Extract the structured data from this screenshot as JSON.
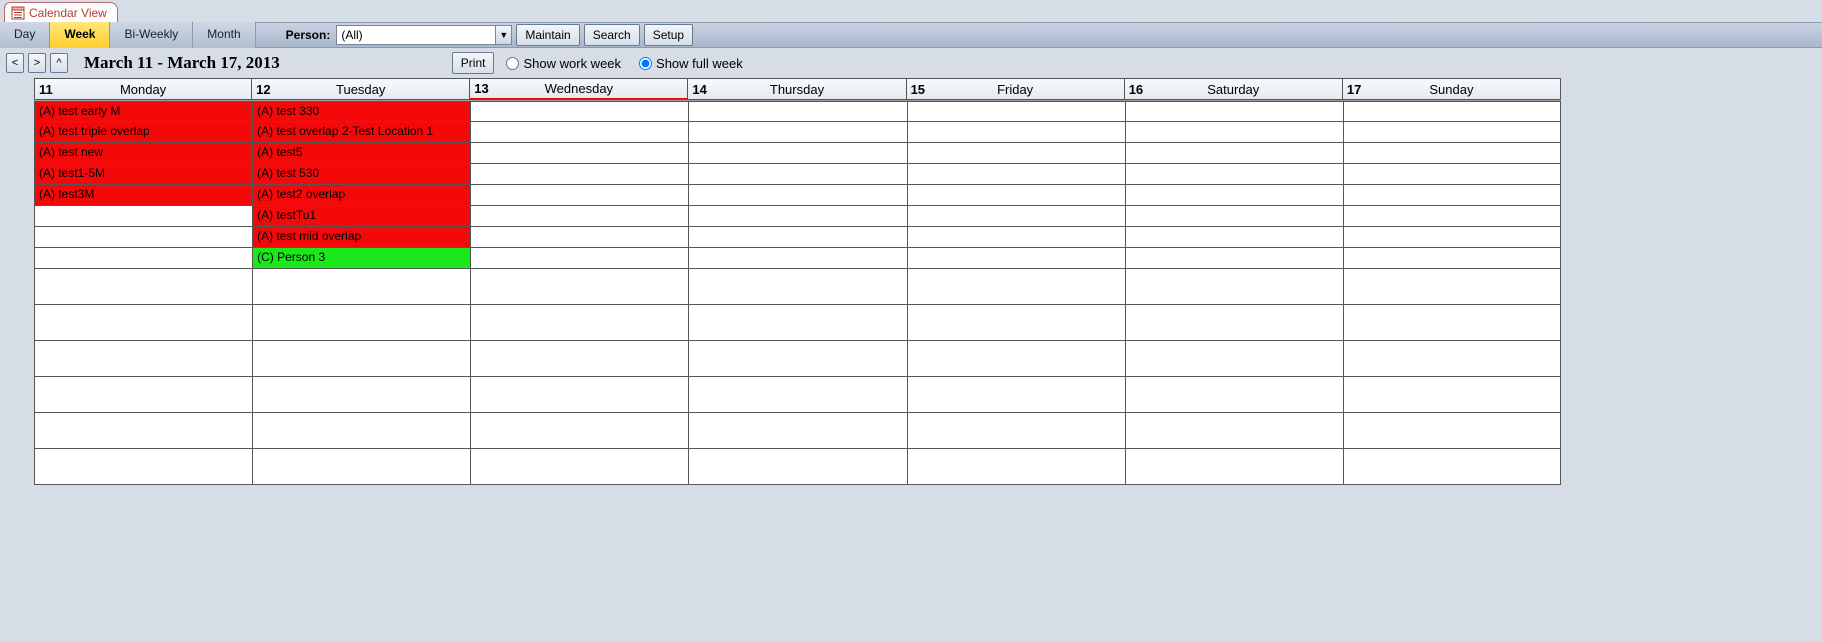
{
  "tab": {
    "label": "Calendar View"
  },
  "views": {
    "day": "Day",
    "week": "Week",
    "biweekly": "Bi-Weekly",
    "month": "Month",
    "active": "week"
  },
  "person": {
    "label": "Person:",
    "selected": "(All)"
  },
  "actions": {
    "maintain": "Maintain",
    "search": "Search",
    "setup": "Setup",
    "print": "Print"
  },
  "nav": {
    "prev": "<",
    "next": ">",
    "up": "^"
  },
  "date_range": "March 11 - March 17, 2013",
  "weekmode": {
    "work_label": "Show work week",
    "full_label": "Show full week",
    "selected": "full"
  },
  "days": [
    {
      "num": "11",
      "name": "Monday"
    },
    {
      "num": "12",
      "name": "Tuesday"
    },
    {
      "num": "13",
      "name": "Wednesday"
    },
    {
      "num": "14",
      "name": "Thursday"
    },
    {
      "num": "15",
      "name": "Friday"
    },
    {
      "num": "16",
      "name": "Saturday"
    },
    {
      "num": "17",
      "name": "Sunday"
    }
  ],
  "rows_per_day": 14,
  "wide_rows": [
    8,
    9,
    10,
    11,
    12,
    13
  ],
  "events": {
    "0": [
      {
        "text": "(A) test early M",
        "cat": "a"
      },
      {
        "text": "(A) test triple overlap",
        "cat": "a"
      },
      {
        "text": "(A) test new",
        "cat": "a"
      },
      {
        "text": "(A) test1-5M",
        "cat": "a"
      },
      {
        "text": "(A) test3M",
        "cat": "a"
      }
    ],
    "1": [
      {
        "text": "(A) test 330",
        "cat": "a"
      },
      {
        "text": "(A) test overlap 2-Test Location 1",
        "cat": "a"
      },
      {
        "text": "(A) test5",
        "cat": "a"
      },
      {
        "text": "(A) test 530",
        "cat": "a"
      },
      {
        "text": "(A) test2 overlap",
        "cat": "a"
      },
      {
        "text": "(A) testTu1",
        "cat": "a"
      },
      {
        "text": "(A) test mid overlap",
        "cat": "a"
      },
      {
        "text": "(C) Person 3",
        "cat": "c"
      }
    ]
  },
  "colors": {
    "cat_a": "#f30909",
    "cat_c": "#1ae81a",
    "chrome": "#d6dde7"
  }
}
